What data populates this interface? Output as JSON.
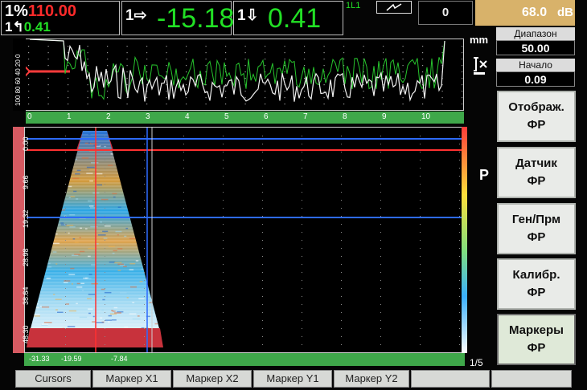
{
  "readouts": {
    "r1_prefix": "1%",
    "r1_value": "110.00",
    "r1_sub_prefix": "1",
    "r1_sub_value": "0.41",
    "r2_prefix": "1⇨",
    "r2_value": "-15.18",
    "r3_prefix": "1⇩",
    "r3_value": "0.41",
    "channel": "1L1",
    "counter": "0",
    "gain_value": "68.0",
    "gain_unit": "dB"
  },
  "params": {
    "units": "mm",
    "range_label": "Диапазон",
    "range_value": "50.00",
    "start_label": "Начало",
    "start_value": "0.09"
  },
  "ascan": {
    "y_ticks": [
      "100",
      "80",
      "60",
      "40",
      "20",
      "0"
    ],
    "x_ticks": [
      "0",
      "1",
      "2",
      "3",
      "4",
      "5",
      "6",
      "7",
      "8",
      "9",
      "10"
    ]
  },
  "sscan": {
    "mode_letter": "P",
    "depth_ticks": [
      "0.00",
      "9.66",
      "19.32",
      "28.98",
      "38.64",
      "48.30"
    ],
    "x_ticks": [
      "-31.33",
      "-19.59",
      "-7.84"
    ]
  },
  "softkeys": [
    {
      "line1": "Отображ.",
      "line2": "ФР"
    },
    {
      "line1": "Датчик",
      "line2": "ФР"
    },
    {
      "line1": "Ген/Прм",
      "line2": "ФР"
    },
    {
      "line1": "Калибр.",
      "line2": "ФР"
    },
    {
      "line1": "Маркеры",
      "line2": "ФР"
    }
  ],
  "page_indicator": "1/5",
  "tabs": [
    "Cursors",
    "Маркер X1",
    "Маркер X2",
    "Маркер Y1",
    "Маркер Y2"
  ],
  "colors": {
    "readout_green": "#22e025",
    "readout_red": "#ff2a2a",
    "gain_bg": "#d8b26a",
    "ruler_green": "#3fa84a",
    "cursor_red": "#ff3030",
    "cursor_blue": "#2d6bff"
  }
}
